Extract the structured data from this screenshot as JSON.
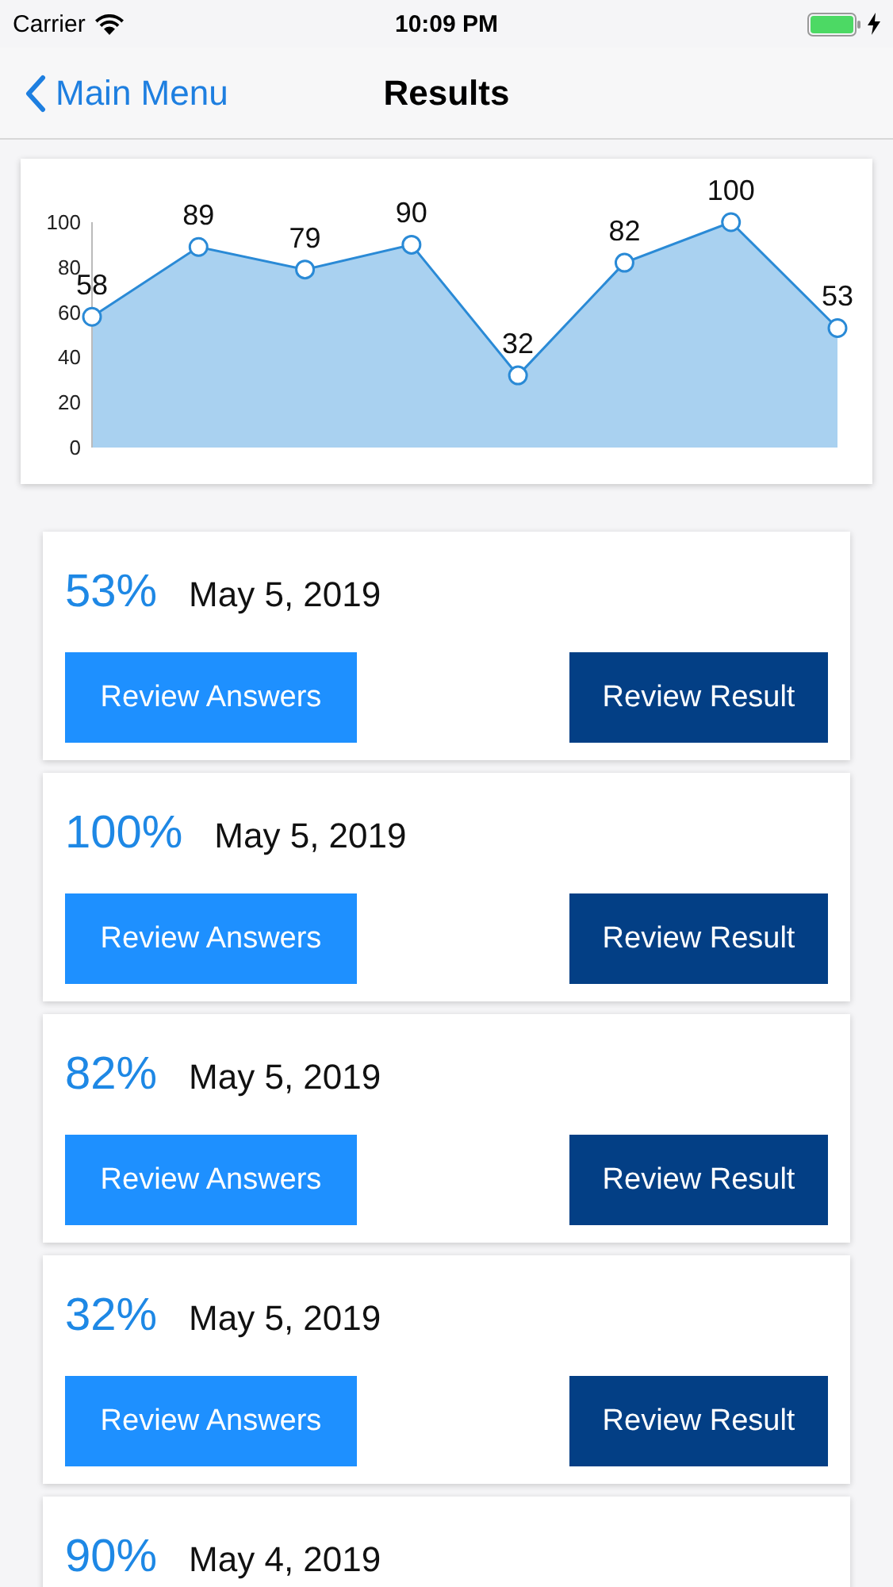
{
  "status_bar": {
    "carrier": "Carrier",
    "time": "10:09 PM"
  },
  "nav": {
    "back_label": "Main Menu",
    "title": "Results"
  },
  "chart_data": {
    "type": "area",
    "categories": [
      null,
      null,
      null,
      null,
      null,
      null,
      null,
      null
    ],
    "series": [
      {
        "color": "#2a8ad6",
        "values": [
          58,
          89,
          79,
          90,
          32,
          82,
          100,
          53
        ]
      }
    ],
    "ylim": [
      0,
      100
    ],
    "yticks": [
      0,
      20,
      40,
      60,
      80,
      100
    ],
    "data_labels": true
  },
  "results": [
    {
      "score": "53%",
      "date": "May 5, 2019",
      "buttons": [
        "Review Answers",
        "Review Result"
      ]
    },
    {
      "score": "100%",
      "date": "May 5, 2019",
      "buttons": [
        "Review Answers",
        "Review Result"
      ]
    },
    {
      "score": "82%",
      "date": "May 5, 2019",
      "buttons": [
        "Review Answers",
        "Review Result"
      ]
    },
    {
      "score": "32%",
      "date": "May 5, 2019",
      "buttons": [
        "Review Answers",
        "Review Result"
      ]
    },
    {
      "score": "90%",
      "date": "May 4, 2019"
    }
  ]
}
